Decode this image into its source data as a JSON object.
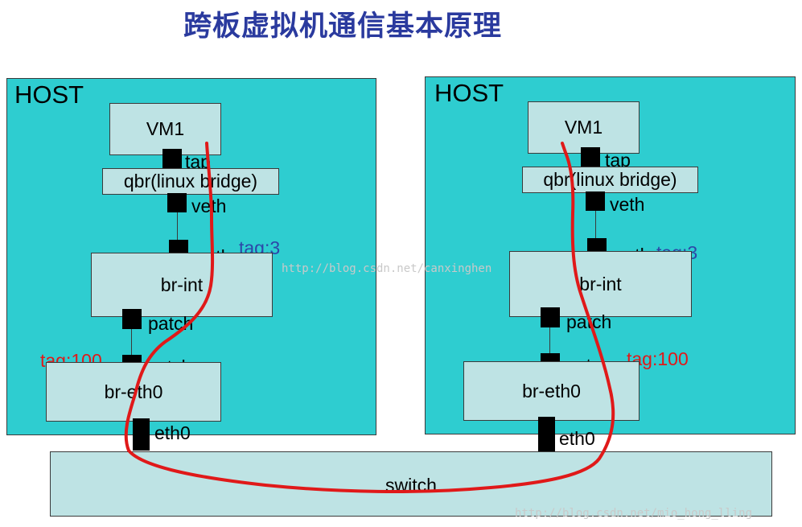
{
  "title": "跨板虚拟机通信基本原理",
  "hosts": [
    {
      "label": "HOST",
      "vm": "VM1",
      "tap": "tap",
      "qbr": "qbr(linux bridge)",
      "veth_top": "veth",
      "veth_bottom": "veth",
      "tag_int": "tag:3",
      "br_int": "br-int",
      "patch_top": "patch",
      "patch_bottom": "patch",
      "tag_eth": "tag:100",
      "br_eth": "br-eth0",
      "eth": "eth0"
    },
    {
      "label": "HOST",
      "vm": "VM1",
      "tap": "tap",
      "qbr": "qbr(linux bridge)",
      "veth_top": "veth",
      "veth_bottom": "veth",
      "tag_int": "tag:3",
      "br_int": "br-int",
      "patch_top": "patch",
      "patch_bottom": "patch",
      "tag_eth": "tag:100",
      "br_eth": "br-eth0",
      "eth": "eth0"
    }
  ],
  "switch": "switch",
  "watermarks": [
    "http://blog.csdn.net/canxinghen",
    "http://blog.csdn.net/mio_hong_lling"
  ],
  "colors": {
    "host_bg": "#2ecdd0",
    "box_bg": "#bee3e4",
    "path": "#e01919",
    "tag_blue": "#2d47a8",
    "title": "#2a3a9e"
  }
}
